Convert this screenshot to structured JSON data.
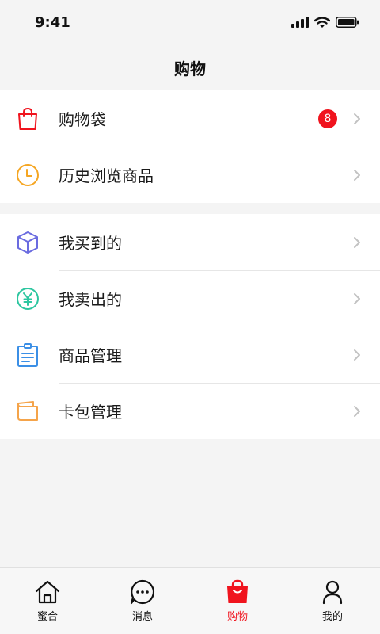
{
  "status_bar": {
    "time": "9:41"
  },
  "nav": {
    "title": "购物"
  },
  "groups": [
    {
      "items": [
        {
          "label": "购物袋",
          "icon": "shopping-bag-icon",
          "badge": "8",
          "color": "#f0141e"
        },
        {
          "label": "历史浏览商品",
          "icon": "clock-icon",
          "color": "#f5a623"
        }
      ]
    },
    {
      "items": [
        {
          "label": "我买到的",
          "icon": "box-icon",
          "color": "#6a6be0"
        },
        {
          "label": "我卖出的",
          "icon": "yen-icon",
          "color": "#2dc6a0"
        },
        {
          "label": "商品管理",
          "icon": "clipboard-icon",
          "color": "#3b8fe6"
        },
        {
          "label": "卡包管理",
          "icon": "card-wallet-icon",
          "color": "#f5a44a"
        }
      ]
    }
  ],
  "tabs": [
    {
      "label": "蜜合",
      "icon": "home-icon",
      "active": false
    },
    {
      "label": "消息",
      "icon": "chat-icon",
      "active": false
    },
    {
      "label": "购物",
      "icon": "shopping-bag-icon",
      "active": true
    },
    {
      "label": "我的",
      "icon": "person-icon",
      "active": false
    }
  ],
  "colors": {
    "accent": "#f0141e",
    "chevron": "#c2c2c2"
  }
}
